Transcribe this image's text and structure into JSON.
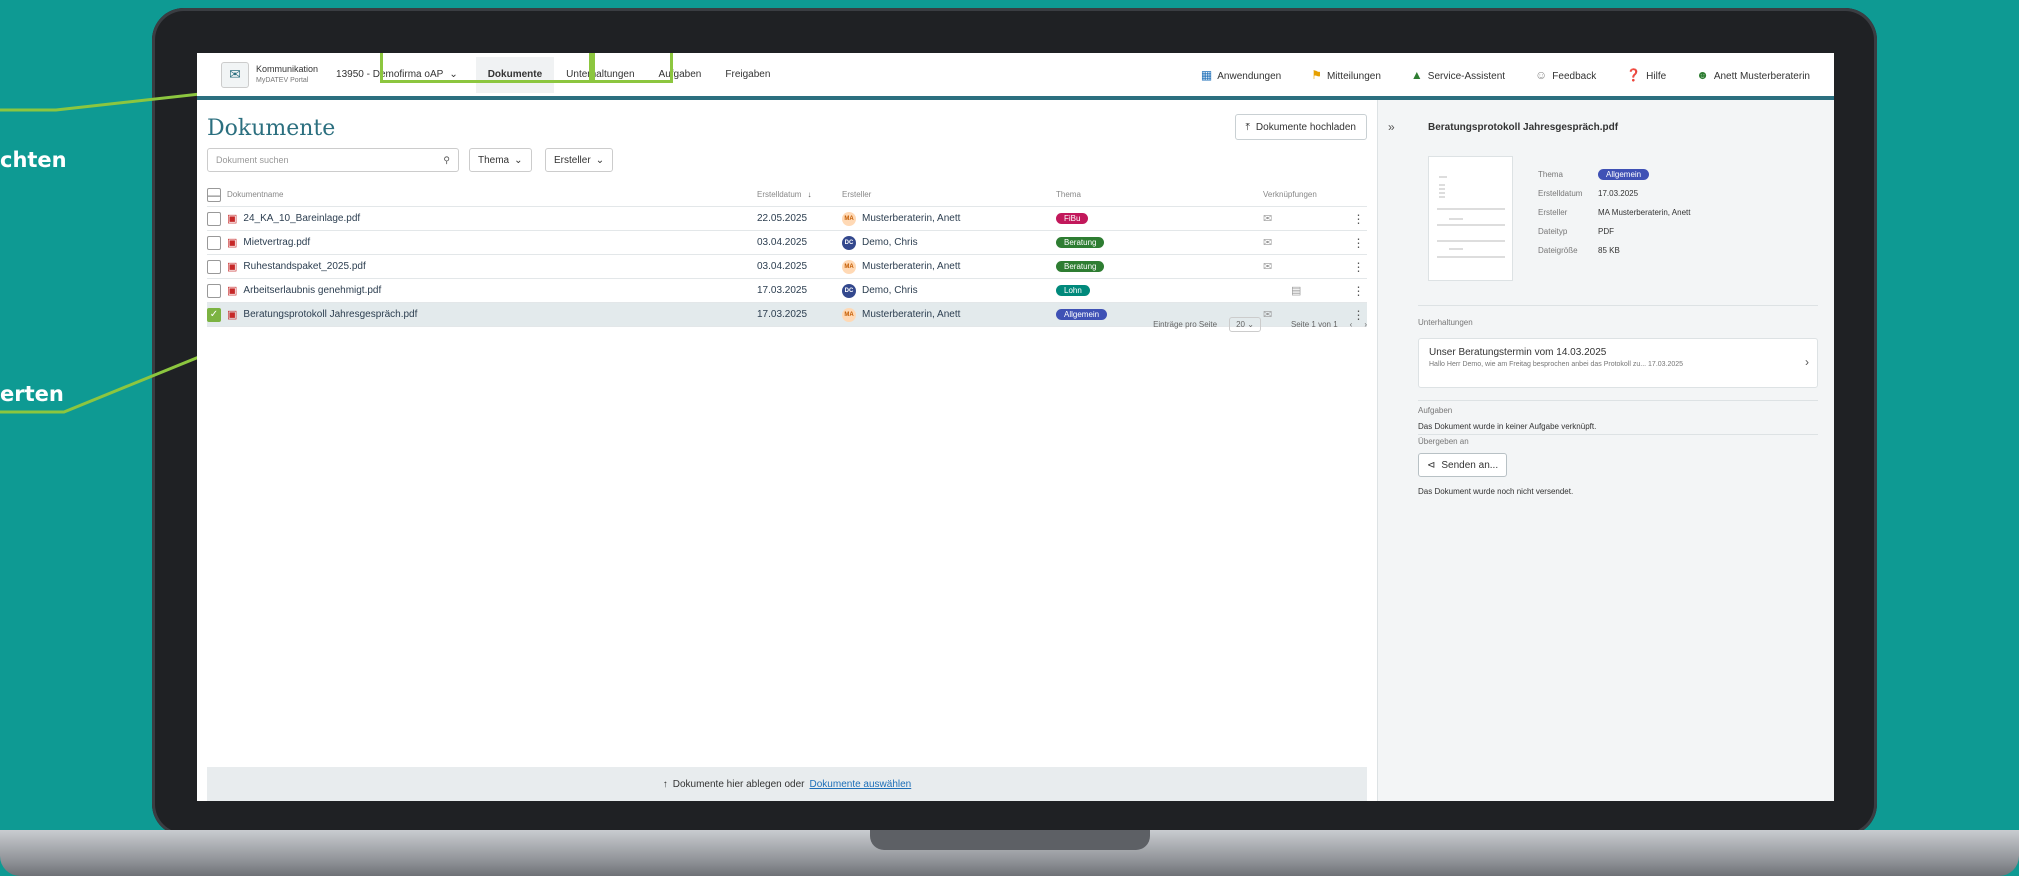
{
  "captions": [
    "chten",
    "erten"
  ],
  "topbar": {
    "brand_line1": "Kommunikation",
    "brand_line2": "MyDATEV Portal",
    "company": "13950 - Demofirma oAP",
    "tabs": [
      "Dokumente",
      "Unterhaltungen",
      "Aufgaben",
      "Freigaben"
    ],
    "right_items": [
      {
        "icon": "grid-icon",
        "label": "Anwendungen"
      },
      {
        "icon": "megaphone-icon",
        "label": "Mitteilungen"
      },
      {
        "icon": "assistant-icon",
        "label": "Service-Assistent"
      },
      {
        "icon": "feedback-icon",
        "label": "Feedback"
      },
      {
        "icon": "help-icon",
        "label": "Hilfe"
      },
      {
        "icon": "user-icon",
        "label": "Anett Musterberaterin"
      }
    ]
  },
  "main": {
    "title": "Dokumente",
    "upload_label": "Dokumente hochladen",
    "search_placeholder": "Dokument suchen",
    "filters": [
      "Thema",
      "Ersteller"
    ],
    "columns": [
      "Dokumentname",
      "Erstelldatum",
      "Ersteller",
      "Thema",
      "Verknüpfungen"
    ],
    "rows": [
      {
        "name": "24_KA_10_Bareinlage.pdf",
        "date": "22.05.2025",
        "initials": "MA",
        "creator": "Musterberaterin, Anett",
        "topic": "FiBu",
        "topic_color": "#c2185b",
        "checked": false
      },
      {
        "name": "Mietvertrag.pdf",
        "date": "03.04.2025",
        "initials": "DC",
        "creator": "Demo, Chris",
        "topic": "Beratung",
        "topic_color": "#2e7d32",
        "checked": false
      },
      {
        "name": "Ruhestandspaket_2025.pdf",
        "date": "03.04.2025",
        "initials": "MA",
        "creator": "Musterberaterin, Anett",
        "topic": "Beratung",
        "topic_color": "#2e7d32",
        "checked": false
      },
      {
        "name": "Arbeitserlaubnis genehmigt.pdf",
        "date": "17.03.2025",
        "initials": "DC",
        "creator": "Demo, Chris",
        "topic": "Lohn",
        "topic_color": "#00897b",
        "checked": false
      },
      {
        "name": "Beratungsprotokoll Jahresgespräch.pdf",
        "date": "17.03.2025",
        "initials": "MA",
        "creator": "Musterberaterin, Anett",
        "topic": "Allgemein",
        "topic_color": "#3f51b5",
        "checked": true
      }
    ],
    "pager_entries_label": "Einträge pro Seite",
    "pager_entries_value": "20",
    "pager_page": "Seite 1 von 1",
    "dropzone_text": "Dokumente hier ablegen oder",
    "dropzone_link": "Dokumente auswählen"
  },
  "side": {
    "title": "Beratungsprotokoll Jahresgespräch.pdf",
    "meta": [
      {
        "k": "Thema",
        "v": "Allgemein"
      },
      {
        "k": "Erstelldatum",
        "v": "17.03.2025"
      },
      {
        "k": "Ersteller",
        "v": "MA  Musterberaterin, Anett"
      },
      {
        "k": "Dateityp",
        "v": "PDF"
      },
      {
        "k": "Dateigröße",
        "v": "85 KB"
      }
    ],
    "conversations_label": "Unterhaltungen",
    "conversation_title": "Unser Beratungstermin vom 14.03.2025",
    "conversation_preview": "Hallo Herr Demo, wie am Freitag besprochen anbei das Protokoll zu... 17.03.2025",
    "tasks_label": "Aufgaben",
    "tasks_text": "Das Dokument wurde in keiner Aufgabe verknüpft.",
    "shared_label": "Übergeben an",
    "send_label": "Senden an...",
    "send_text": "Das Dokument wurde noch nicht versendet."
  },
  "colors": {
    "brand": "#2b6f7f",
    "highlight": "#8cc63f",
    "background": "#0e9a93"
  }
}
